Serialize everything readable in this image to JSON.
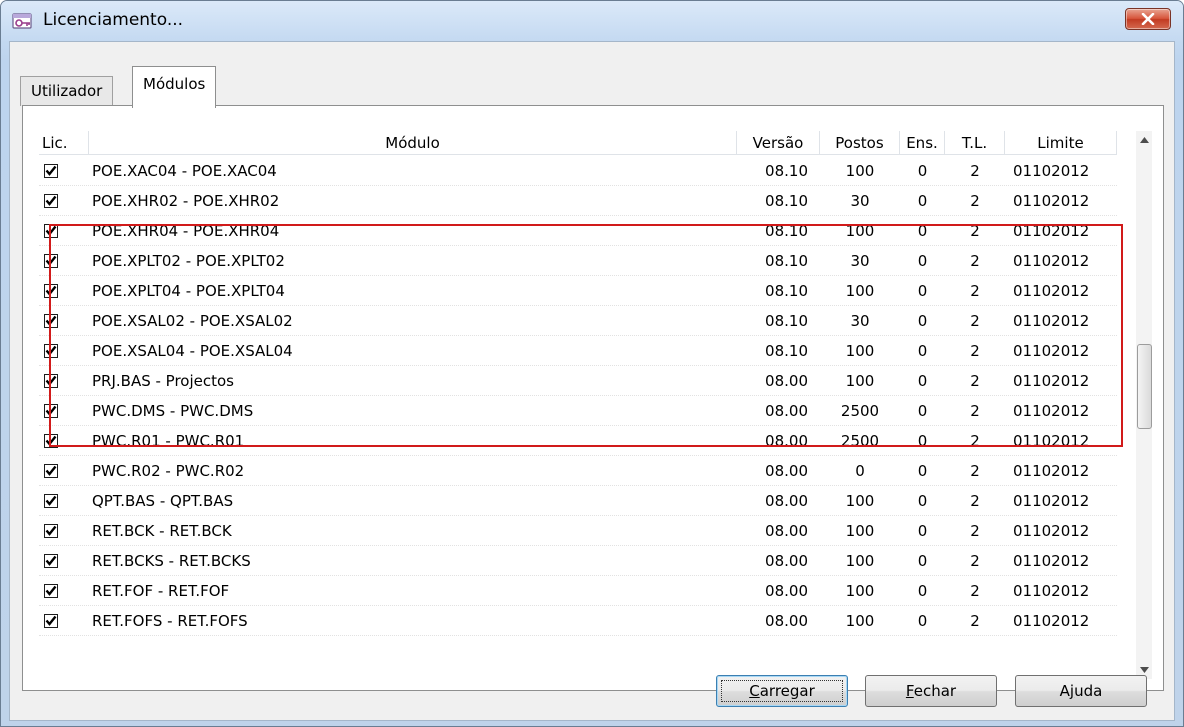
{
  "window": {
    "title": "Licenciamento..."
  },
  "tabs": [
    {
      "label": "Utilizador",
      "active": false
    },
    {
      "label": "Módulos",
      "active": true
    }
  ],
  "columns": {
    "lic": "Lic.",
    "modulo": "Módulo",
    "versao": "Versão",
    "postos": "Postos",
    "ens": "Ens.",
    "tl": "T.L.",
    "limite": "Limite"
  },
  "rows": [
    {
      "checked": true,
      "modulo": "POE.XAC04 - POE.XAC04",
      "versao": "08.10",
      "postos": "100",
      "ens": "0",
      "tl": "2",
      "limite": "01102012"
    },
    {
      "checked": true,
      "modulo": "POE.XHR02 - POE.XHR02",
      "versao": "08.10",
      "postos": "30",
      "ens": "0",
      "tl": "2",
      "limite": "01102012"
    },
    {
      "checked": true,
      "modulo": "POE.XHR04 - POE.XHR04",
      "versao": "08.10",
      "postos": "100",
      "ens": "0",
      "tl": "2",
      "limite": "01102012"
    },
    {
      "checked": true,
      "modulo": "POE.XPLT02 - POE.XPLT02",
      "versao": "08.10",
      "postos": "30",
      "ens": "0",
      "tl": "2",
      "limite": "01102012"
    },
    {
      "checked": true,
      "modulo": "POE.XPLT04 - POE.XPLT04",
      "versao": "08.10",
      "postos": "100",
      "ens": "0",
      "tl": "2",
      "limite": "01102012"
    },
    {
      "checked": true,
      "modulo": "POE.XSAL02 - POE.XSAL02",
      "versao": "08.10",
      "postos": "30",
      "ens": "0",
      "tl": "2",
      "limite": "01102012"
    },
    {
      "checked": true,
      "modulo": "POE.XSAL04 - POE.XSAL04",
      "versao": "08.10",
      "postos": "100",
      "ens": "0",
      "tl": "2",
      "limite": "01102012"
    },
    {
      "checked": true,
      "modulo": "PRJ.BAS - Projectos",
      "versao": "08.00",
      "postos": "100",
      "ens": "0",
      "tl": "2",
      "limite": "01102012"
    },
    {
      "checked": true,
      "modulo": "PWC.DMS - PWC.DMS",
      "versao": "08.00",
      "postos": "2500",
      "ens": "0",
      "tl": "2",
      "limite": "01102012"
    },
    {
      "checked": true,
      "modulo": "PWC.R01 - PWC.R01",
      "versao": "08.00",
      "postos": "2500",
      "ens": "0",
      "tl": "2",
      "limite": "01102012"
    },
    {
      "checked": true,
      "modulo": "PWC.R02 - PWC.R02",
      "versao": "08.00",
      "postos": "0",
      "ens": "0",
      "tl": "2",
      "limite": "01102012"
    },
    {
      "checked": true,
      "modulo": "QPT.BAS - QPT.BAS",
      "versao": "08.00",
      "postos": "100",
      "ens": "0",
      "tl": "2",
      "limite": "01102012"
    },
    {
      "checked": true,
      "modulo": "RET.BCK - RET.BCK",
      "versao": "08.00",
      "postos": "100",
      "ens": "0",
      "tl": "2",
      "limite": "01102012"
    },
    {
      "checked": true,
      "modulo": "RET.BCKS - RET.BCKS",
      "versao": "08.00",
      "postos": "100",
      "ens": "0",
      "tl": "2",
      "limite": "01102012"
    },
    {
      "checked": true,
      "modulo": "RET.FOF - RET.FOF",
      "versao": "08.00",
      "postos": "100",
      "ens": "0",
      "tl": "2",
      "limite": "01102012"
    },
    {
      "checked": true,
      "modulo": "RET.FOFS - RET.FOFS",
      "versao": "08.00",
      "postos": "100",
      "ens": "0",
      "tl": "2",
      "limite": "01102012"
    }
  ],
  "buttons": {
    "carregar": {
      "pre": "",
      "acc": "C",
      "post": "arregar"
    },
    "fechar": {
      "pre": "",
      "acc": "F",
      "post": "echar"
    },
    "ajuda": {
      "pre": "A",
      "acc": "j",
      "post": "uda"
    }
  },
  "colors": {
    "highlight": "#d11a1a",
    "close_button": "#c23b22"
  },
  "icons": {
    "window": "license-key-icon",
    "close": "close-icon",
    "check": "checkmark-icon"
  }
}
